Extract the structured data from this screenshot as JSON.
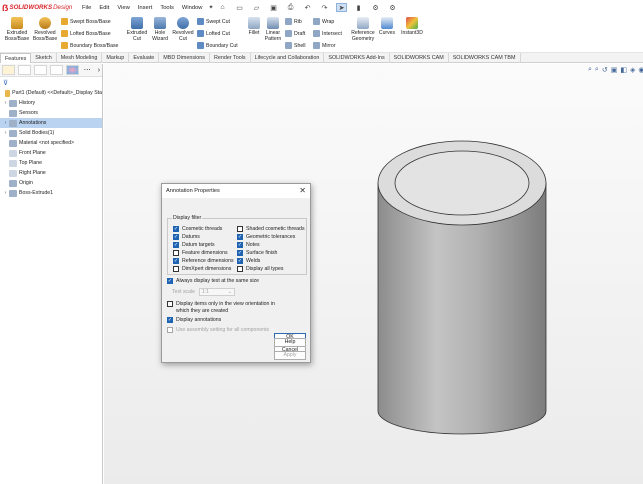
{
  "app": {
    "brand": "SOLIDWORKS",
    "product": "Design"
  },
  "menu": [
    "File",
    "Edit",
    "View",
    "Insert",
    "Tools",
    "Window"
  ],
  "ribbon": {
    "extruded_boss": "Extruded Boss/Base",
    "revolved_boss": "Revolved Boss/Base",
    "swept_boss": "Swept Boss/Base",
    "lofted_boss": "Lofted Boss/Base",
    "boundary_boss": "Boundary Boss/Base",
    "extruded_cut": "Extruded Cut",
    "hole_wizard": "Hole Wizard",
    "revolved_cut": "Revolved Cut",
    "swept_cut": "Swept Cut",
    "lofted_cut": "Lofted Cut",
    "boundary_cut": "Boundary Cut",
    "fillet": "Fillet",
    "linear_pattern": "Linear Pattern",
    "rib": "Rib",
    "draft": "Draft",
    "shell": "Shell",
    "wrap": "Wrap",
    "intersect": "Intersect",
    "mirror": "Mirror",
    "reference_geometry": "Reference Geometry",
    "curves": "Curves",
    "instant3d": "Instant3D"
  },
  "tabs": [
    "Features",
    "Sketch",
    "Mesh Modeling",
    "Markup",
    "Evaluate",
    "MBD Dimensions",
    "Render Tools",
    "Lifecycle and Collaboration",
    "SOLIDWORKS Add-Ins",
    "SOLIDWORKS CAM",
    "SOLIDWORKS CAM TBM"
  ],
  "tree": [
    {
      "label": "Part1 (Default) <<Default>_Display Sta",
      "icon": "part-icon",
      "indent": 0,
      "arrow": ""
    },
    {
      "label": "History",
      "icon": "history-icon",
      "indent": 1,
      "arrow": "›"
    },
    {
      "label": "Sensors",
      "icon": "sensor-icon",
      "indent": 1,
      "arrow": ""
    },
    {
      "label": "Annotations",
      "icon": "annotation-icon",
      "indent": 1,
      "arrow": "›",
      "selected": true
    },
    {
      "label": "Solid Bodies(1)",
      "icon": "solid-bodies-icon",
      "indent": 1,
      "arrow": "›"
    },
    {
      "label": "Material <not specified>",
      "icon": "material-icon",
      "indent": 1,
      "arrow": ""
    },
    {
      "label": "Front Plane",
      "icon": "plane-icon",
      "indent": 1,
      "arrow": ""
    },
    {
      "label": "Top Plane",
      "icon": "plane-icon",
      "indent": 1,
      "arrow": ""
    },
    {
      "label": "Right Plane",
      "icon": "plane-icon",
      "indent": 1,
      "arrow": ""
    },
    {
      "label": "Origin",
      "icon": "origin-icon",
      "indent": 1,
      "arrow": ""
    },
    {
      "label": "Boss-Extrude1",
      "icon": "extrude-feature-icon",
      "indent": 1,
      "arrow": "›"
    }
  ],
  "dialog": {
    "title": "Annotation Properties",
    "display_filter": "Display filter",
    "filters_left": [
      {
        "label": "Cosmetic threads",
        "checked": true
      },
      {
        "label": "Datums",
        "checked": true
      },
      {
        "label": "Datum targets",
        "checked": true
      },
      {
        "label": "Feature dimensions",
        "checked": false
      },
      {
        "label": "Reference dimensions",
        "checked": true
      },
      {
        "label": "DimXpert dimensions",
        "checked": false
      }
    ],
    "filters_right": [
      {
        "label": "Shaded cosmetic threads",
        "checked": false
      },
      {
        "label": "Geometric tolerances",
        "checked": true
      },
      {
        "label": "Notes",
        "checked": true
      },
      {
        "label": "Surface finish",
        "checked": true
      },
      {
        "label": "Welds",
        "checked": true
      },
      {
        "label": "Display all types",
        "checked": false
      }
    ],
    "always_same_size": "Always display text at the same size",
    "text_scale_label": "Text scale",
    "text_scale_value": "1:1",
    "view_orientation": "Display items only in the view orientation in which they are created",
    "display_annotations": "Display annotations",
    "use_assembly": "Use assembly setting for all components",
    "ok": "OK",
    "cancel": "Cancel",
    "help": "Help",
    "apply": "Apply"
  },
  "colors": {
    "accent": "#1f63b3",
    "brand": "#d8262c",
    "selection": "#b9d3f0"
  }
}
